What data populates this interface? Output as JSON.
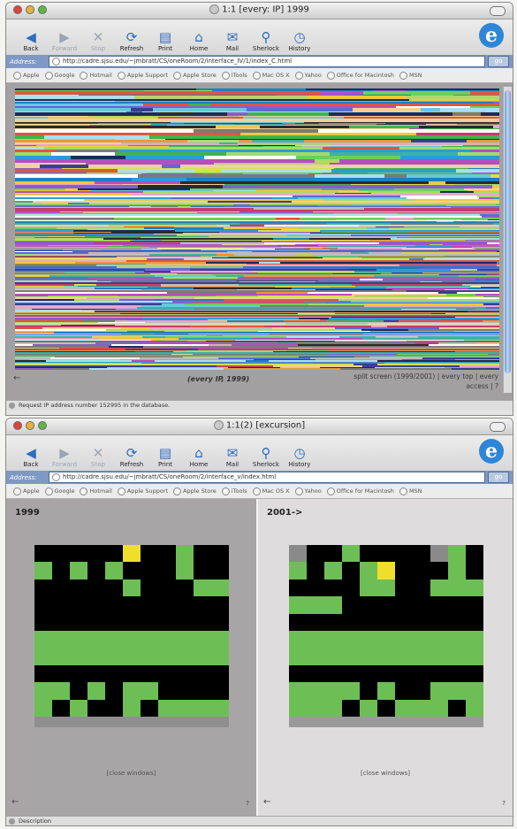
{
  "window1": {
    "title": "1:1 [every: IP] 1999",
    "toolbar": [
      {
        "label": "Back",
        "icon": "back-arrow-icon",
        "glyph": "◀",
        "disabled": false
      },
      {
        "label": "Forward",
        "icon": "forward-arrow-icon",
        "glyph": "▶",
        "disabled": true
      },
      {
        "label": "Stop",
        "icon": "stop-icon",
        "glyph": "✕",
        "disabled": true
      },
      {
        "label": "Refresh",
        "icon": "refresh-icon",
        "glyph": "⟳",
        "disabled": false
      },
      {
        "label": "Print",
        "icon": "print-icon",
        "glyph": "▤",
        "disabled": false
      },
      {
        "label": "Home",
        "icon": "home-icon",
        "glyph": "⌂",
        "disabled": false
      },
      {
        "label": "Mail",
        "icon": "mail-icon",
        "glyph": "✉",
        "disabled": false
      },
      {
        "label": "Sherlock",
        "icon": "sherlock-icon",
        "glyph": "⚲",
        "disabled": false
      },
      {
        "label": "History",
        "icon": "history-icon",
        "glyph": "◷",
        "disabled": false
      }
    ],
    "address_label": "Address:",
    "url": "http://cadre.sjsu.edu/~jmbratt/CS/oneRoom/2/interface_IV/1/index_C.html",
    "go_label": "go",
    "favorites": [
      "Apple",
      "Google",
      "Hotmail",
      "Apple Support",
      "Apple Store",
      "iTools",
      "Mac OS X",
      "Yahoo",
      "Office for Macintosh",
      "MSN"
    ],
    "back_glyph": "←",
    "caption": "(every IP, 1999)",
    "right_links": "split screen (1999/2001) | every  top | every access | ?",
    "status": "Request IP address number 152995 in the database."
  },
  "window2": {
    "title": "1:1(2) [excursion]",
    "url": "http://cadre.sjsu.edu/~jmbratt/CS/oneRoom/2/interface_v/index.html",
    "status": "Description",
    "left_pane": {
      "year": "1999",
      "close_label": "[close windows]",
      "back_glyph": "←",
      "help": "?"
    },
    "right_pane": {
      "year": "2001->",
      "close_label": "[close windows]",
      "back_glyph": "←",
      "help": "?"
    }
  },
  "colors": {
    "stripe_palette": [
      "#2e9ad6",
      "#1e7fbd",
      "#43b34b",
      "#6ecf5a",
      "#a2db6b",
      "#d7e14a",
      "#f0c93b",
      "#e89a3a",
      "#e0563d",
      "#c53d6e",
      "#b44fc0",
      "#8b5bd0",
      "#5b6ad6",
      "#3b3f8f",
      "#1d2a5a",
      "#68c8d8",
      "#a9e0ef",
      "#e7a6c8",
      "#f0d0a0",
      "#ffffff",
      "#bcbcbc",
      "#7a7a7a",
      "#2a2a2a",
      "#b0d76a",
      "#3fb2a0"
    ],
    "grid_green": "#6dbf55",
    "grid_yellow": "#f0df2a"
  },
  "grids": {
    "grid_1999": [
      "kkkkkkkkgkk",
      "gkgkgkkkgkk",
      "kkkkkgkkkgg",
      "kkkkkkkkkkk",
      "kkkkkkkkkkk",
      "ggggggggggg",
      "ggggggggggg",
      "kkkkkkkkkkk",
      "ggkgkggkkkk",
      "gkgkkgkgggg"
    ],
    "yellow_1999": [
      0,
      5
    ],
    "grid_2001": [
      "xkkgkkkkxgk",
      "gkgkggkkkgk",
      "kkkkggkkggg",
      "gggkkkkkkkk",
      "kkkkkkkkkkk",
      "ggggggggggg",
      "ggggggggggg",
      "kkkkkkkkkkk",
      "ggggkgkkggg",
      "gggkgkgggkg"
    ],
    "yellow_2001": [
      1,
      5
    ]
  }
}
